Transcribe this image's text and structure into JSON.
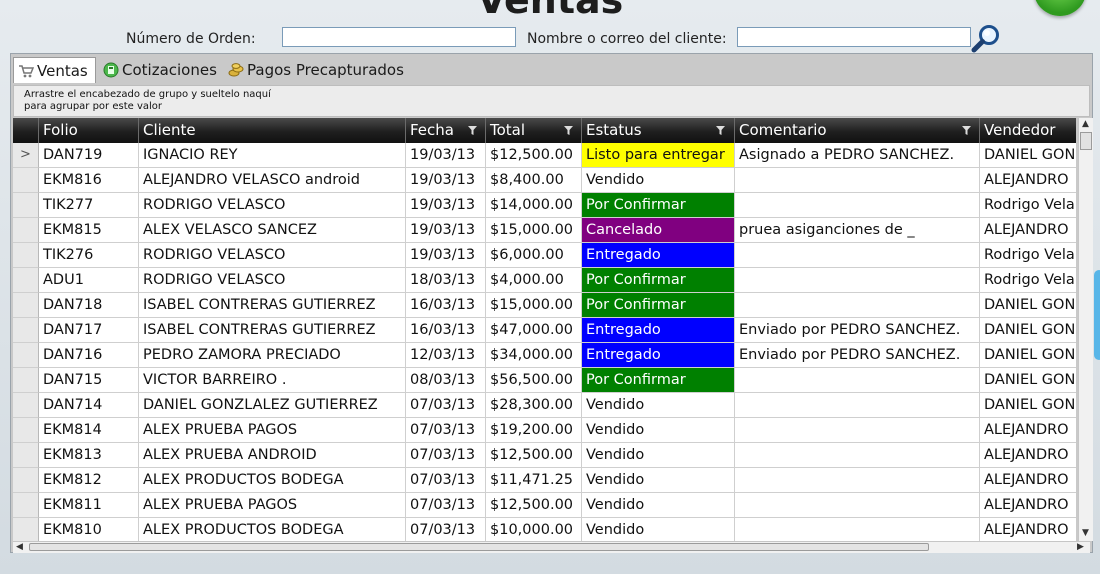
{
  "page": {
    "title": "Ventas"
  },
  "search": {
    "order_label": "Número de Orden:",
    "order_value": "",
    "client_label": "Nombre o correo del cliente:",
    "client_value": ""
  },
  "tabs": [
    {
      "label": "Ventas",
      "icon": "cart-icon",
      "active": true
    },
    {
      "label": "Cotizaciones",
      "icon": "calculator-icon",
      "active": false
    },
    {
      "label": "Pagos Precapturados",
      "icon": "coins-icon",
      "active": false
    }
  ],
  "group_hint": "Arrastre el encabezado de grupo y sueltelo naquí para agrupar por este valor",
  "grid": {
    "columns": [
      "Folio",
      "Cliente",
      "Fecha",
      "Total",
      "Estatus",
      "Comentario",
      "Vendedor"
    ],
    "rows": [
      {
        "folio": "DAN719",
        "cliente": "IGNACIO  REY",
        "fecha": "19/03/13",
        "total": "$12,500.00",
        "estatus": "Listo para entregar",
        "comentario": "Asignado a PEDRO SANCHEZ.",
        "vendedor": "DANIEL GON"
      },
      {
        "folio": "EKM816",
        "cliente": "ALEJANDRO VELASCO android",
        "fecha": "19/03/13",
        "total": "$8,400.00",
        "estatus": "Vendido",
        "comentario": "",
        "vendedor": "ALEJANDRO"
      },
      {
        "folio": "TIK277",
        "cliente": "RODRIGO VELASCO",
        "fecha": "19/03/13",
        "total": "$14,000.00",
        "estatus": "Por Confirmar",
        "comentario": "",
        "vendedor": "Rodrigo Vela"
      },
      {
        "folio": "EKM815",
        "cliente": "ALEX VELASCO SANCEZ",
        "fecha": "19/03/13",
        "total": "$15,000.00",
        "estatus": "Cancelado",
        "comentario": "pruea asiganciones de _",
        "vendedor": "ALEJANDRO"
      },
      {
        "folio": "TIK276",
        "cliente": "RODRIGO VELASCO",
        "fecha": "19/03/13",
        "total": "$6,000.00",
        "estatus": "Entregado",
        "comentario": "",
        "vendedor": "Rodrigo Vela"
      },
      {
        "folio": "ADU1",
        "cliente": "RODRIGO VELASCO",
        "fecha": "18/03/13",
        "total": "$4,000.00",
        "estatus": "Por Confirmar",
        "comentario": "",
        "vendedor": "Rodrigo Vela"
      },
      {
        "folio": "DAN718",
        "cliente": "ISABEL CONTRERAS GUTIERREZ",
        "fecha": "16/03/13",
        "total": "$15,000.00",
        "estatus": "Por Confirmar",
        "comentario": "",
        "vendedor": "DANIEL GON"
      },
      {
        "folio": "DAN717",
        "cliente": "ISABEL CONTRERAS GUTIERREZ",
        "fecha": "16/03/13",
        "total": "$47,000.00",
        "estatus": "Entregado",
        "comentario": "Enviado por PEDRO SANCHEZ.",
        "vendedor": "DANIEL GON"
      },
      {
        "folio": "DAN716",
        "cliente": "PEDRO ZAMORA PRECIADO",
        "fecha": "12/03/13",
        "total": "$34,000.00",
        "estatus": "Entregado",
        "comentario": "Enviado por PEDRO SANCHEZ.",
        "vendedor": "DANIEL GON"
      },
      {
        "folio": "DAN715",
        "cliente": "VICTOR BARREIRO .",
        "fecha": "08/03/13",
        "total": "$56,500.00",
        "estatus": "Por Confirmar",
        "comentario": "",
        "vendedor": "DANIEL GON"
      },
      {
        "folio": "DAN714",
        "cliente": "DANIEL  GONZLALEZ  GUTIERREZ",
        "fecha": "07/03/13",
        "total": "$28,300.00",
        "estatus": "Vendido",
        "comentario": "",
        "vendedor": "DANIEL GON"
      },
      {
        "folio": "EKM814",
        "cliente": "ALEX PRUEBA  PAGOS",
        "fecha": "07/03/13",
        "total": "$19,200.00",
        "estatus": "Vendido",
        "comentario": "",
        "vendedor": "ALEJANDRO"
      },
      {
        "folio": "EKM813",
        "cliente": "ALEX PRUEBA ANDROID",
        "fecha": "07/03/13",
        "total": "$12,500.00",
        "estatus": "Vendido",
        "comentario": "",
        "vendedor": "ALEJANDRO"
      },
      {
        "folio": "EKM812",
        "cliente": "ALEX  PRODUCTOS BODEGA",
        "fecha": "07/03/13",
        "total": "$11,471.25",
        "estatus": "Vendido",
        "comentario": "",
        "vendedor": "ALEJANDRO"
      },
      {
        "folio": "EKM811",
        "cliente": "ALEX PRUEBA  PAGOS",
        "fecha": "07/03/13",
        "total": "$12,500.00",
        "estatus": "Vendido",
        "comentario": "",
        "vendedor": "ALEJANDRO"
      },
      {
        "folio": "EKM810",
        "cliente": "ALEX  PRODUCTOS BODEGA",
        "fecha": "07/03/13",
        "total": "$10,000.00",
        "estatus": "Vendido",
        "comentario": "",
        "vendedor": "ALEJANDRO"
      }
    ],
    "selected_row_marker": ">"
  },
  "status_colors": {
    "Listo para entregar": {
      "bg": "#ffff00",
      "fg": "#111111"
    },
    "Por Confirmar": {
      "bg": "#008000",
      "fg": "#ffffff"
    },
    "Cancelado": {
      "bg": "#800080",
      "fg": "#ffffff"
    },
    "Entregado": {
      "bg": "#0000ff",
      "fg": "#ffffff"
    },
    "Vendido": {
      "bg": "#ffffff",
      "fg": "#111111"
    }
  }
}
